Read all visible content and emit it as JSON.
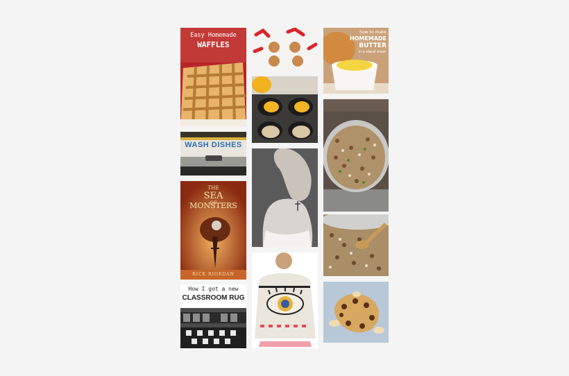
{
  "tiles": {
    "waffles": {
      "line1": "Easy Homemade",
      "line2": "WAFFLES"
    },
    "wash": {
      "text": "WASH DISHES"
    },
    "book": {
      "the": "THE",
      "sea": "SEA",
      "of": "OF",
      "monsters": "MONSTERS",
      "author": "RICK RIORDAN"
    },
    "rug": {
      "line1": "How I got a new",
      "line2": "CLASSROOM RUG"
    },
    "butter": {
      "line1": "how to make",
      "line2": "HOMEMADE",
      "line3": "BUTTER",
      "line4": "in a stand mixer"
    }
  },
  "colors": {
    "background": "#f4f4f4"
  }
}
